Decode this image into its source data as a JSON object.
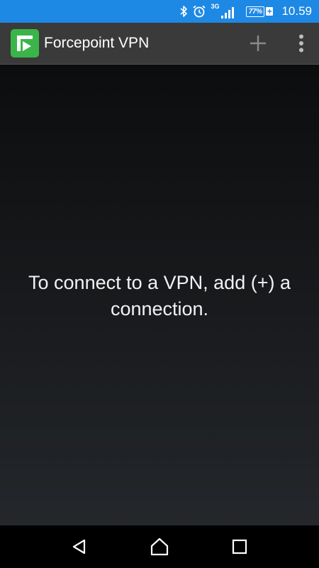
{
  "status_bar": {
    "network": "3G",
    "battery_percent": "77%",
    "battery_charging": "+",
    "time": "10.59",
    "icons": [
      "bluetooth-icon",
      "alarm-icon",
      "signal-icon",
      "battery-icon"
    ],
    "background_color": "#1e88e5"
  },
  "app_bar": {
    "title": "Forcepoint VPN",
    "logo": "forcepoint-logo",
    "actions": [
      "add-icon",
      "overflow-menu-icon"
    ],
    "logo_color": "#3bb54a"
  },
  "main": {
    "empty_message": "To connect to a VPN, add (+) a connection."
  },
  "nav_bar": {
    "buttons": [
      "back-icon",
      "home-icon",
      "recents-icon"
    ]
  }
}
